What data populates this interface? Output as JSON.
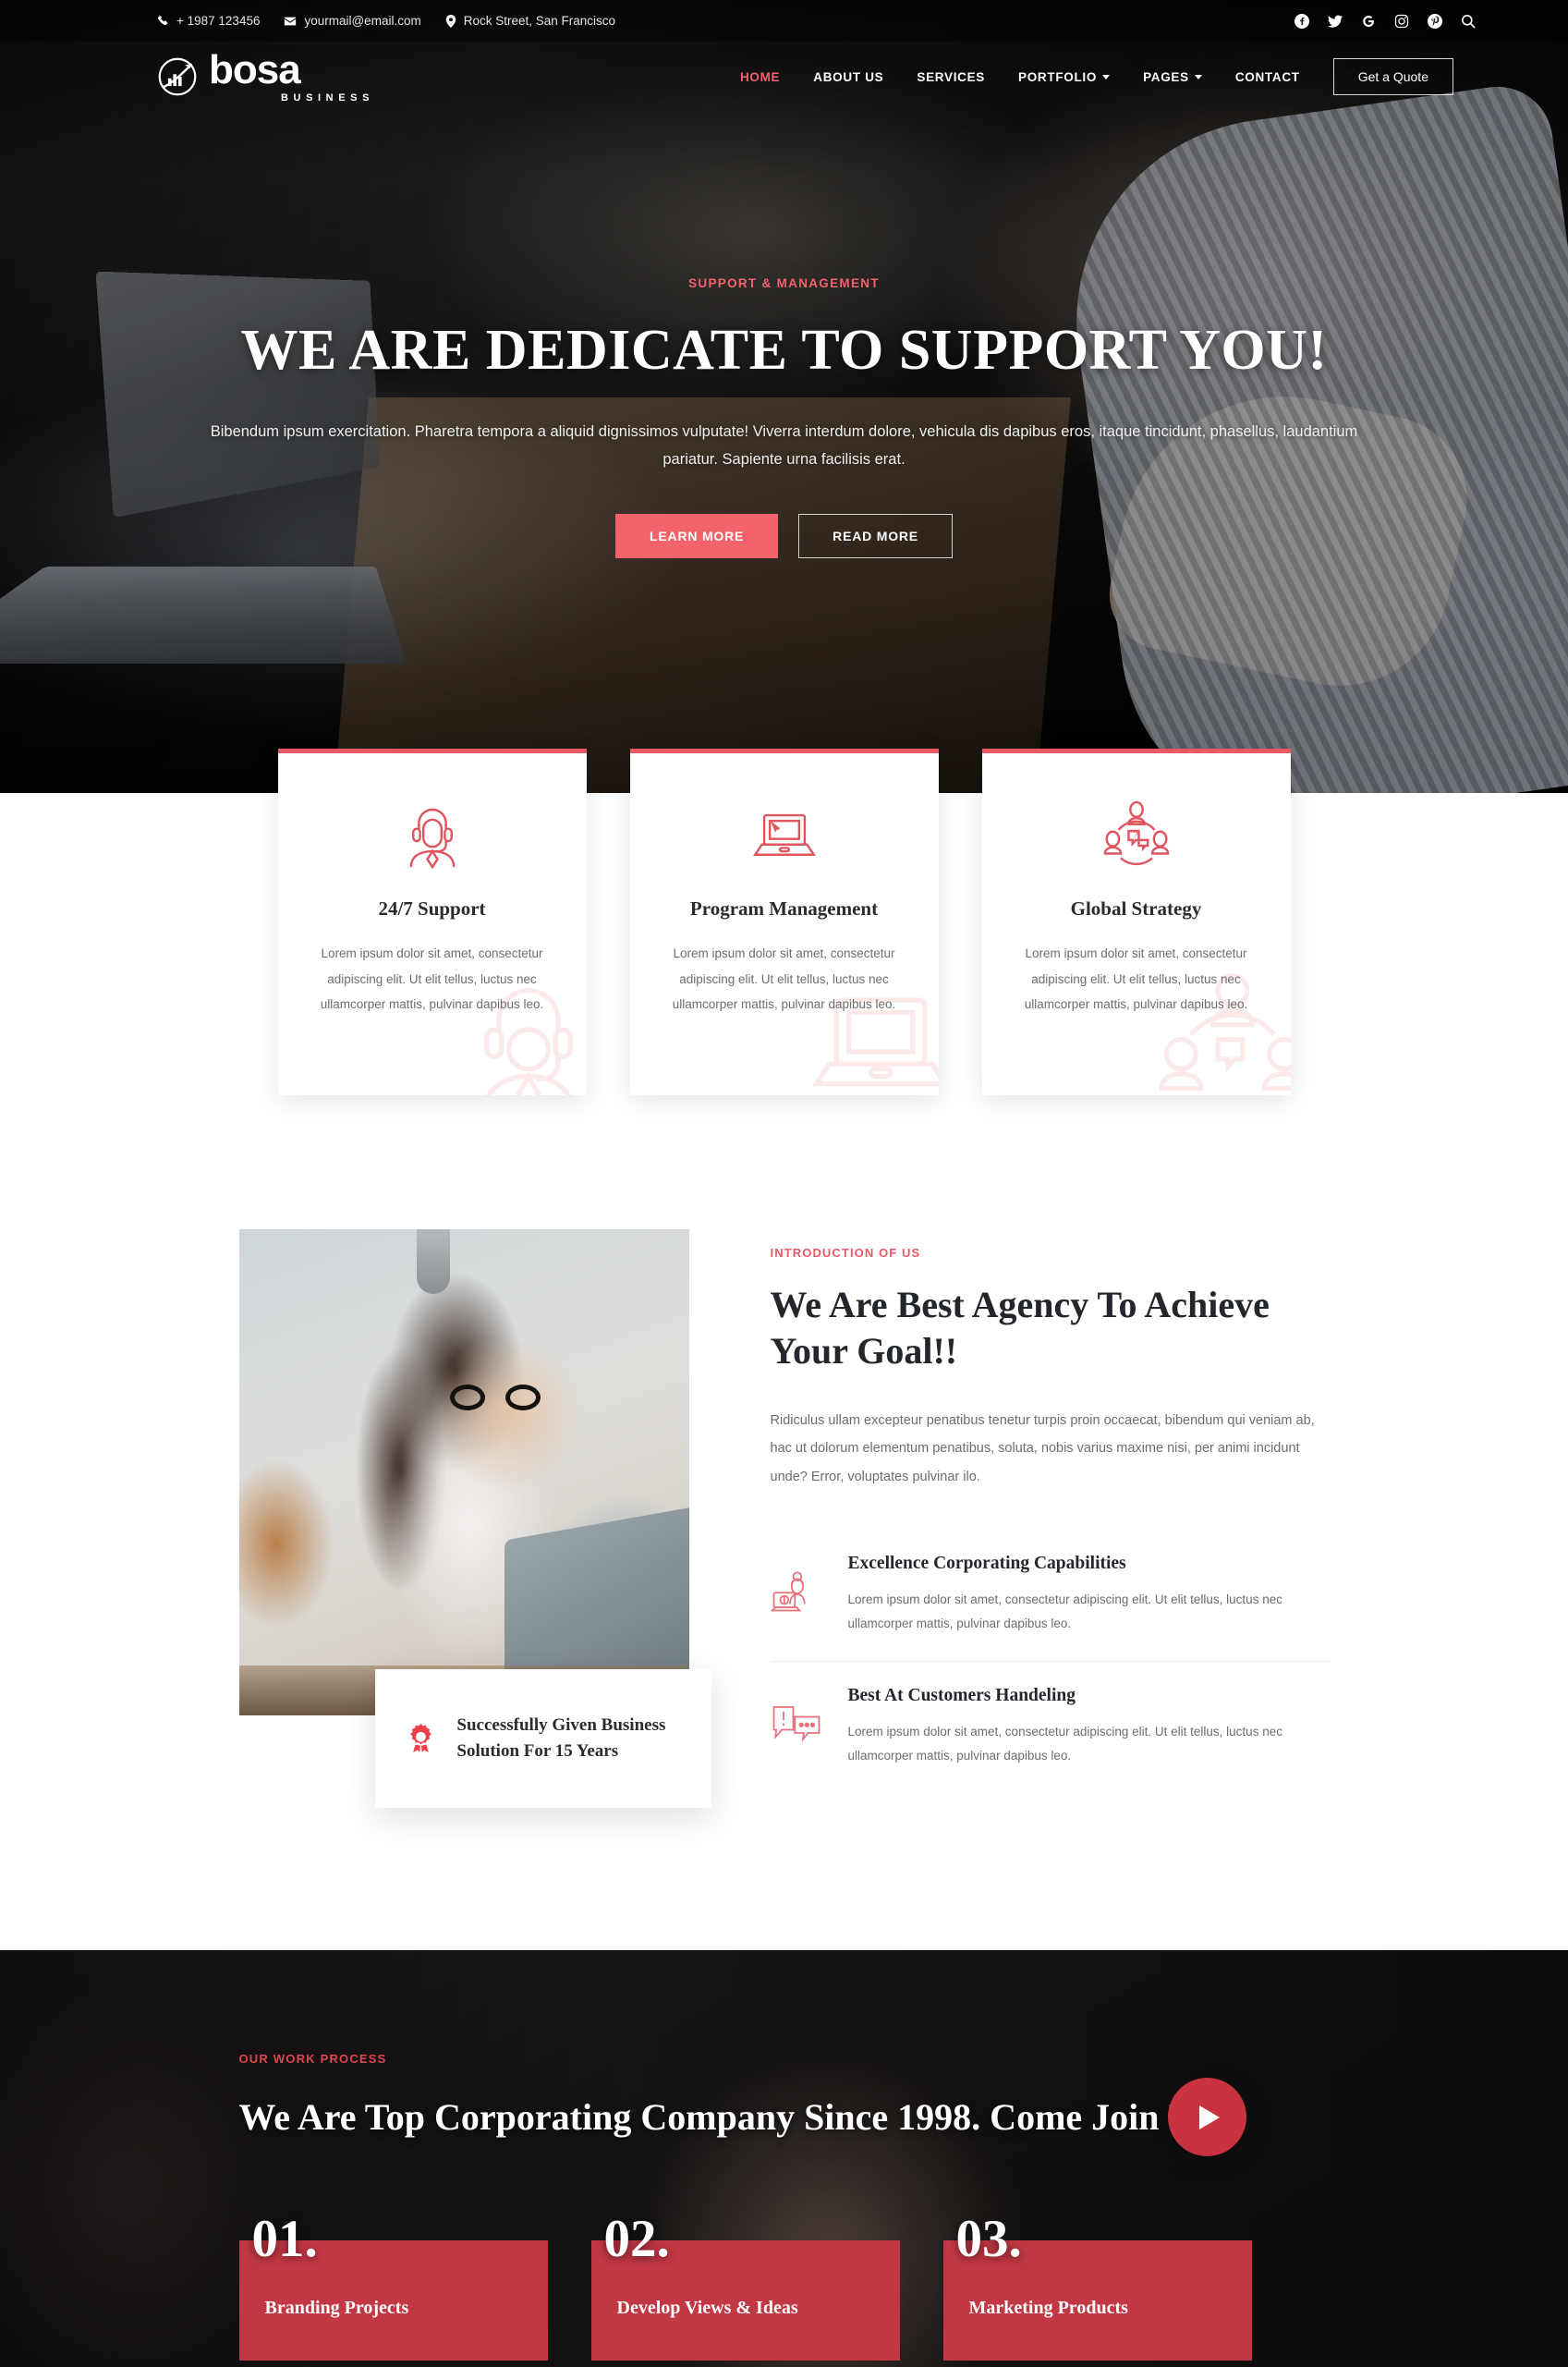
{
  "colors": {
    "accent": "#ea5a64",
    "accent_bright": "#f2636b",
    "dark_red": "#c23744",
    "dark": "#1d1b1b"
  },
  "topbar": {
    "phone": "+ 1987 123456",
    "email": "yourmail@email.com",
    "address": "Rock Street, San Francisco",
    "socials": [
      "facebook-icon",
      "twitter-icon",
      "google-icon",
      "instagram-icon",
      "pinterest-icon",
      "search-icon"
    ]
  },
  "brand": {
    "name": "bosa",
    "sub": "BUSINESS"
  },
  "nav": {
    "items": [
      {
        "label": "HOME",
        "active": true,
        "caret": false
      },
      {
        "label": "ABOUT US",
        "active": false,
        "caret": false
      },
      {
        "label": "SERVICES",
        "active": false,
        "caret": false
      },
      {
        "label": "PORTFOLIO",
        "active": false,
        "caret": true
      },
      {
        "label": "PAGES",
        "active": false,
        "caret": true
      },
      {
        "label": "CONTACT",
        "active": false,
        "caret": false
      }
    ],
    "quote_label": "Get a Quote"
  },
  "hero": {
    "eyebrow": "SUPPORT & MANAGEMENT",
    "title": "WE ARE DEDICATE TO SUPPORT YOU!",
    "subtitle": "Bibendum ipsum exercitation. Pharetra tempora a aliquid dignissimos vulputate! Viverra interdum dolore, vehicula dis dapibus eros, itaque tincidunt, phasellus, laudantium pariatur. Sapiente urna facilisis erat.",
    "primary_btn": "LEARN MORE",
    "secondary_btn": "READ MORE"
  },
  "cards": [
    {
      "icon": "headset-agent-icon",
      "title": "24/7 Support",
      "body": "Lorem ipsum dolor sit amet, consectetur adipiscing elit. Ut elit tellus, luctus nec ullamcorper mattis, pulvinar dapibus leo."
    },
    {
      "icon": "laptop-icon",
      "title": "Program Management",
      "body": "Lorem ipsum dolor sit amet, consectetur adipiscing elit. Ut elit tellus, luctus nec ullamcorper mattis, pulvinar dapibus leo."
    },
    {
      "icon": "team-strategy-icon",
      "title": "Global Strategy",
      "body": "Lorem ipsum dolor sit amet, consectetur adipiscing elit. Ut elit tellus, luctus nec ullamcorper mattis, pulvinar dapibus leo."
    }
  ],
  "intro": {
    "eyebrow": "INTRODUCTION OF US",
    "title": "We Are Best Agency To Achieve Your Goal!!",
    "paragraph": "Ridiculus ullam excepteur penatibus tenetur turpis proin occaecat, bibendum qui veniam ab, hac ut dolorum elementum penatibus, soluta, nobis varius maxime nisi, per animi incidunt unde? Error, voluptates pulvinar ilo.",
    "badge": {
      "icon": "award-ribbon-icon",
      "text": "Successfully Given Business Solution For 15 Years"
    },
    "features": [
      {
        "icon": "woman-laptop-icon",
        "title": "Excellence Corporating Capabilities",
        "body": "Lorem ipsum dolor sit amet, consectetur adipiscing elit. Ut elit tellus, luctus nec ullamcorper mattis, pulvinar dapibus leo."
      },
      {
        "icon": "chat-alert-icon",
        "title": "Best At Customers Handeling",
        "body": "Lorem ipsum dolor sit amet, consectetur adipiscing elit. Ut elit tellus, luctus nec ullamcorper mattis, pulvinar dapibus leo."
      }
    ]
  },
  "process": {
    "eyebrow": "OUR WORK PROCESS",
    "title": "We Are Top Corporating Company Since 1998. Come Join Us!",
    "play_icon": "play-icon",
    "steps": [
      {
        "num": "01.",
        "label": "Branding Projects"
      },
      {
        "num": "02.",
        "label": "Develop Views & Ideas"
      },
      {
        "num": "03.",
        "label": "Marketing Products"
      }
    ]
  }
}
